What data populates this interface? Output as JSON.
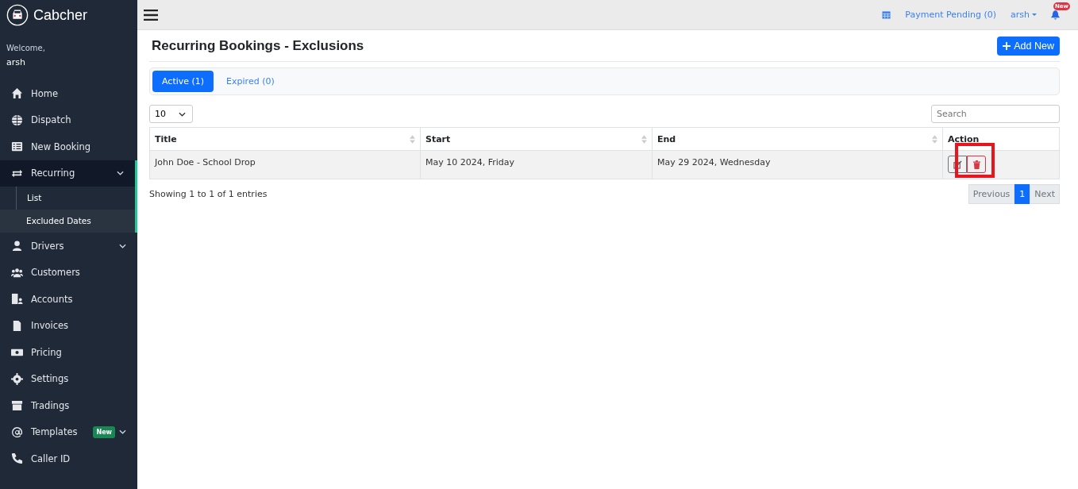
{
  "brand": {
    "name": "Cabcher"
  },
  "welcome": {
    "greeting": "Welcome,",
    "user": "arsh"
  },
  "sidebar": {
    "items": [
      {
        "label": "Home",
        "selected": false
      },
      {
        "label": "Dispatch",
        "selected": false
      },
      {
        "label": "New Booking",
        "selected": false
      },
      {
        "label": "Recurring",
        "selected": true,
        "expandable": true,
        "expanded": true,
        "children": [
          {
            "label": "List",
            "selected": false
          },
          {
            "label": "Excluded Dates",
            "selected": true
          }
        ]
      },
      {
        "label": "Drivers",
        "selected": false,
        "expandable": true,
        "expanded": false
      },
      {
        "label": "Customers",
        "selected": false
      },
      {
        "label": "Accounts",
        "selected": false
      },
      {
        "label": "Invoices",
        "selected": false
      },
      {
        "label": "Pricing",
        "selected": false
      },
      {
        "label": "Settings",
        "selected": false
      },
      {
        "label": "Tradings",
        "selected": false
      },
      {
        "label": "Templates",
        "selected": false,
        "badge": "New",
        "expandable": true,
        "expanded": false
      },
      {
        "label": "Caller ID",
        "selected": false
      }
    ]
  },
  "topbar": {
    "payment_link": "Payment Pending (0)",
    "user": "arsh",
    "notification_badge": "New"
  },
  "page": {
    "title": "Recurring Bookings - Exclusions",
    "add_button": "Add New"
  },
  "tabs": [
    {
      "label": "Active (1)",
      "selected": true
    },
    {
      "label": "Expired (0)",
      "selected": false
    }
  ],
  "page_size": {
    "value": "10"
  },
  "search": {
    "placeholder": "Search"
  },
  "table": {
    "columns": [
      {
        "label": "Title",
        "sortable": true
      },
      {
        "label": "Start",
        "sortable": true
      },
      {
        "label": "End",
        "sortable": true
      },
      {
        "label": "Action",
        "sortable": false
      }
    ],
    "rows": [
      {
        "title": "John Doe - School Drop",
        "start": "May 10 2024, Friday",
        "end": "May 29 2024, Wednesday"
      }
    ]
  },
  "info": "Showing 1 to 1 of 1 entries",
  "pagination": {
    "previous": {
      "label": "Previous",
      "disabled": true
    },
    "pages": [
      {
        "label": "1",
        "selected": true
      }
    ],
    "next": {
      "label": "Next",
      "disabled": true
    }
  },
  "annotation": {
    "highlight": true
  }
}
